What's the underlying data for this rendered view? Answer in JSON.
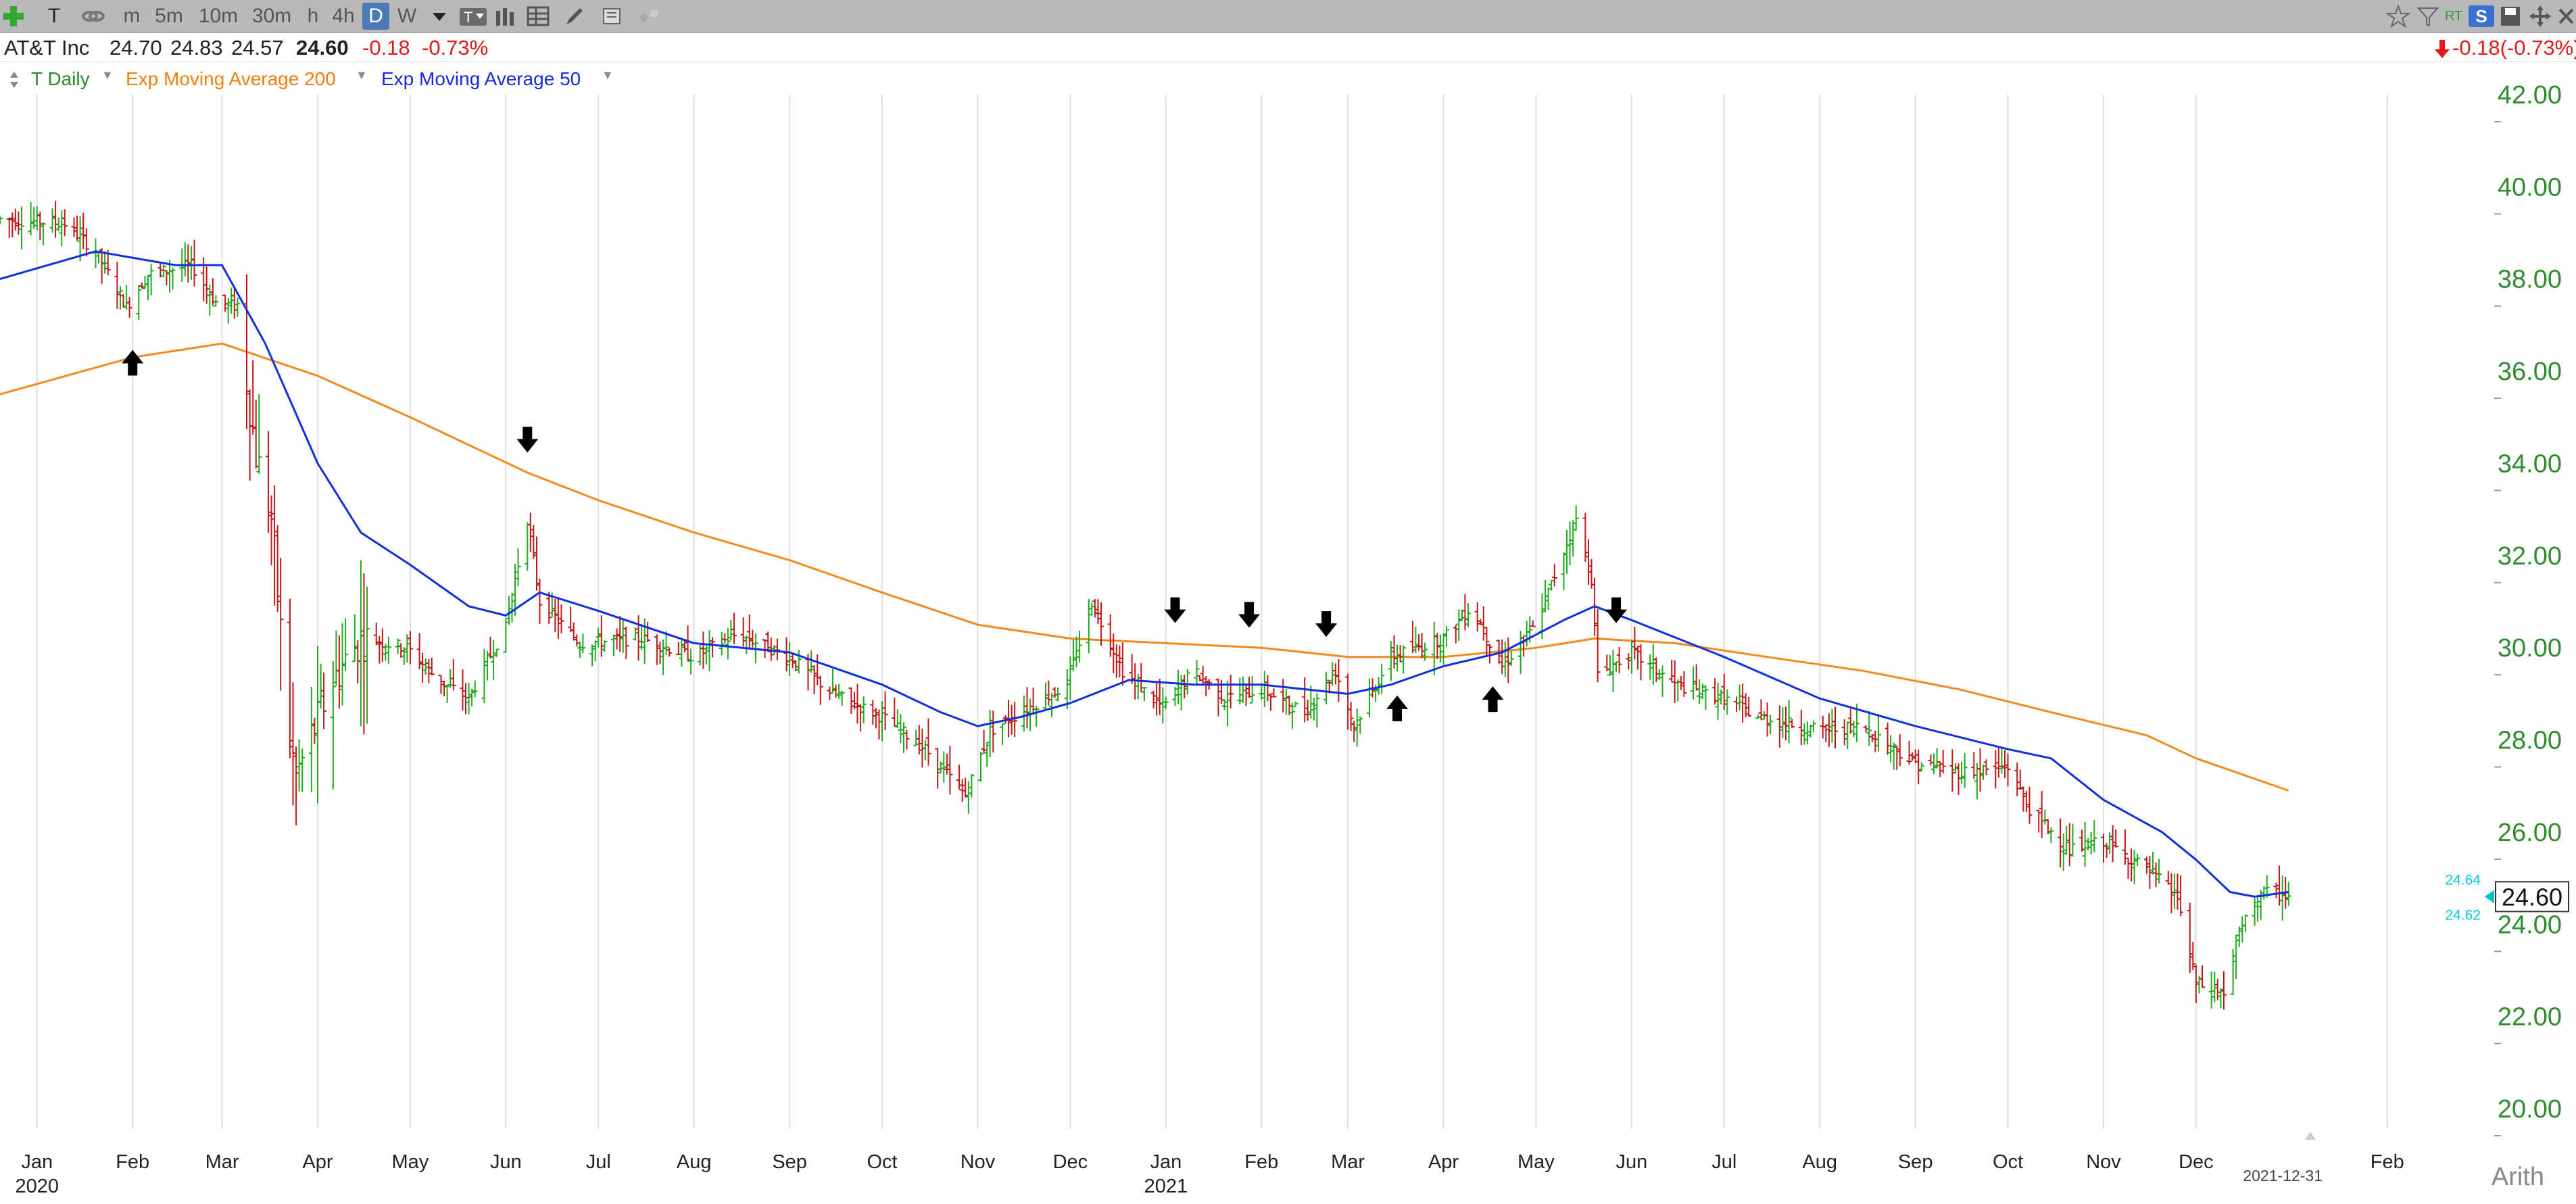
{
  "toolbar": {
    "items": [
      "T",
      "m",
      "5m",
      "10m",
      "30m",
      "h",
      "4h",
      "D",
      "W"
    ],
    "selected": "D",
    "right_items": [
      "RT",
      "S"
    ]
  },
  "info": {
    "name": "AT&T Inc",
    "open": "24.70",
    "high": "24.83",
    "low": "24.57",
    "close": "24.60",
    "change": "-0.18",
    "change_pct": "-0.73%",
    "right_change": "-0.18(-0.73%)"
  },
  "legend": {
    "series_main": "T Daily",
    "series_ema200": "Exp Moving Average 200",
    "series_ema50": "Exp Moving Average 50",
    "color_main": "#2a8a2a",
    "color_ema200": "#f07d0a",
    "color_ema50": "#1428e6"
  },
  "colors": {
    "up": "#1faa1f",
    "down": "#c01818",
    "ema200": "#f38a1f",
    "ema50": "#1030e0",
    "grid": "#dedede",
    "axis": "#2e8b2e"
  },
  "footer": {
    "scale_label": "Arith",
    "last_date_label": "2021-12-31"
  },
  "chart_data": {
    "type": "ohlc",
    "ylim": [
      20,
      42
    ],
    "yticks": [
      "42.00",
      "40.00",
      "38.00",
      "36.00",
      "34.00",
      "32.00",
      "30.00",
      "28.00",
      "26.00",
      "24.00",
      "22.00",
      "20.00"
    ],
    "last_price": "24.60",
    "side_labels": [
      "24.64",
      "24.62"
    ],
    "month_labels": [
      {
        "label": "Jan",
        "date": "2020-01-01"
      },
      {
        "label": "Feb",
        "date": "2020-02-01"
      },
      {
        "label": "Mar",
        "date": "2020-03-01"
      },
      {
        "label": "Apr",
        "date": "2020-04-01"
      },
      {
        "label": "May",
        "date": "2020-05-01"
      },
      {
        "label": "Jun",
        "date": "2020-06-01"
      },
      {
        "label": "Jul",
        "date": "2020-07-01"
      },
      {
        "label": "Aug",
        "date": "2020-08-01"
      },
      {
        "label": "Sep",
        "date": "2020-09-01"
      },
      {
        "label": "Oct",
        "date": "2020-10-01"
      },
      {
        "label": "Nov",
        "date": "2020-11-01"
      },
      {
        "label": "Dec",
        "date": "2020-12-01"
      },
      {
        "label": "Jan",
        "date": "2021-01-01"
      },
      {
        "label": "Feb",
        "date": "2021-02-01"
      },
      {
        "label": "Mar",
        "date": "2021-03-01"
      },
      {
        "label": "Apr",
        "date": "2021-04-01"
      },
      {
        "label": "May",
        "date": "2021-05-01"
      },
      {
        "label": "Jun",
        "date": "2021-06-01"
      },
      {
        "label": "Jul",
        "date": "2021-07-01"
      },
      {
        "label": "Aug",
        "date": "2021-08-01"
      },
      {
        "label": "Sep",
        "date": "2021-09-01"
      },
      {
        "label": "Oct",
        "date": "2021-10-01"
      },
      {
        "label": "Nov",
        "date": "2021-11-01"
      },
      {
        "label": "Dec",
        "date": "2021-12-01"
      },
      {
        "label": "Feb",
        "date": "2022-02-01"
      }
    ],
    "year_labels": [
      {
        "label": "2020",
        "date": "2020-01-01"
      },
      {
        "label": "2021",
        "date": "2021-01-01"
      }
    ],
    "x_start": "2019-12-20",
    "x_end": "2022-02-28",
    "price_path": [
      [
        "2019-12-20",
        39.3
      ],
      [
        "2020-01-10",
        39.2
      ],
      [
        "2020-01-20",
        38.6
      ],
      [
        "2020-01-30",
        37.4
      ],
      [
        "2020-02-06",
        38.1
      ],
      [
        "2020-02-20",
        38.3
      ],
      [
        "2020-02-28",
        37.5
      ],
      [
        "2020-03-06",
        37.4
      ],
      [
        "2020-03-12",
        34.2
      ],
      [
        "2020-03-17",
        32.8
      ],
      [
        "2020-03-23",
        28.0
      ],
      [
        "2020-03-25",
        27.2
      ],
      [
        "2020-04-06",
        29.3
      ],
      [
        "2020-04-15",
        30.2
      ],
      [
        "2020-04-30",
        30.0
      ],
      [
        "2020-05-10",
        29.3
      ],
      [
        "2020-05-20",
        28.9
      ],
      [
        "2020-06-01",
        30.5
      ],
      [
        "2020-06-08",
        32.8
      ],
      [
        "2020-06-12",
        31.0
      ],
      [
        "2020-06-25",
        30.1
      ],
      [
        "2020-07-15",
        30.2
      ],
      [
        "2020-08-01",
        29.8
      ],
      [
        "2020-08-15",
        30.3
      ],
      [
        "2020-09-01",
        29.8
      ],
      [
        "2020-09-15",
        29.0
      ],
      [
        "2020-10-01",
        28.5
      ],
      [
        "2020-10-15",
        27.8
      ],
      [
        "2020-10-28",
        26.8
      ],
      [
        "2020-11-05",
        28.2
      ],
      [
        "2020-11-15",
        28.6
      ],
      [
        "2020-11-30",
        29.2
      ],
      [
        "2020-12-08",
        31.0
      ],
      [
        "2020-12-18",
        29.5
      ],
      [
        "2020-12-31",
        28.7
      ],
      [
        "2021-01-10",
        29.5
      ],
      [
        "2021-01-20",
        28.9
      ],
      [
        "2021-02-01",
        29.1
      ],
      [
        "2021-02-15",
        28.6
      ],
      [
        "2021-02-25",
        29.5
      ],
      [
        "2021-03-03",
        28.3
      ],
      [
        "2021-03-15",
        29.8
      ],
      [
        "2021-04-01",
        30.2
      ],
      [
        "2021-04-10",
        30.9
      ],
      [
        "2021-04-20",
        29.6
      ],
      [
        "2021-04-30",
        30.4
      ],
      [
        "2021-05-05",
        31.2
      ],
      [
        "2021-05-14",
        32.8
      ],
      [
        "2021-05-19",
        31.5
      ],
      [
        "2021-05-21",
        29.4
      ],
      [
        "2021-06-01",
        29.9
      ],
      [
        "2021-06-15",
        29.2
      ],
      [
        "2021-07-01",
        28.9
      ],
      [
        "2021-07-12",
        28.5
      ],
      [
        "2021-08-01",
        28.2
      ],
      [
        "2021-08-15",
        28.3
      ],
      [
        "2021-09-01",
        27.5
      ],
      [
        "2021-09-15",
        27.3
      ],
      [
        "2021-10-01",
        27.4
      ],
      [
        "2021-10-08",
        26.5
      ],
      [
        "2021-10-21",
        25.6
      ],
      [
        "2021-11-01",
        25.8
      ],
      [
        "2021-11-15",
        25.2
      ],
      [
        "2021-11-25",
        24.6
      ],
      [
        "2021-12-01",
        22.7
      ],
      [
        "2021-12-10",
        22.5
      ],
      [
        "2021-12-15",
        23.8
      ],
      [
        "2021-12-22",
        24.7
      ],
      [
        "2021-12-31",
        24.6
      ]
    ],
    "ema200": [
      [
        "2019-12-20",
        35.5
      ],
      [
        "2020-02-01",
        36.3
      ],
      [
        "2020-03-01",
        36.6
      ],
      [
        "2020-04-01",
        35.9
      ],
      [
        "2020-05-01",
        35.0
      ],
      [
        "2020-06-08",
        33.8
      ],
      [
        "2020-07-01",
        33.2
      ],
      [
        "2020-08-01",
        32.5
      ],
      [
        "2020-09-01",
        31.9
      ],
      [
        "2020-10-01",
        31.2
      ],
      [
        "2020-11-01",
        30.5
      ],
      [
        "2020-12-01",
        30.2
      ],
      [
        "2021-01-01",
        30.1
      ],
      [
        "2021-02-01",
        30.0
      ],
      [
        "2021-03-01",
        29.8
      ],
      [
        "2021-04-01",
        29.8
      ],
      [
        "2021-05-01",
        30.0
      ],
      [
        "2021-05-20",
        30.2
      ],
      [
        "2021-06-15",
        30.1
      ],
      [
        "2021-07-15",
        29.8
      ],
      [
        "2021-08-15",
        29.5
      ],
      [
        "2021-09-15",
        29.1
      ],
      [
        "2021-10-15",
        28.6
      ],
      [
        "2021-11-15",
        28.1
      ],
      [
        "2021-12-01",
        27.6
      ],
      [
        "2021-12-31",
        26.9
      ]
    ],
    "ema50": [
      [
        "2019-12-20",
        38.0
      ],
      [
        "2020-01-20",
        38.6
      ],
      [
        "2020-02-15",
        38.3
      ],
      [
        "2020-03-01",
        38.3
      ],
      [
        "2020-03-15",
        36.6
      ],
      [
        "2020-04-01",
        34.0
      ],
      [
        "2020-04-15",
        32.5
      ],
      [
        "2020-05-01",
        31.8
      ],
      [
        "2020-05-20",
        30.9
      ],
      [
        "2020-06-01",
        30.7
      ],
      [
        "2020-06-12",
        31.2
      ],
      [
        "2020-07-01",
        30.8
      ],
      [
        "2020-08-01",
        30.1
      ],
      [
        "2020-09-01",
        29.9
      ],
      [
        "2020-10-01",
        29.2
      ],
      [
        "2020-10-20",
        28.6
      ],
      [
        "2020-11-01",
        28.3
      ],
      [
        "2020-11-15",
        28.5
      ],
      [
        "2020-12-01",
        28.8
      ],
      [
        "2020-12-20",
        29.3
      ],
      [
        "2021-01-10",
        29.2
      ],
      [
        "2021-02-01",
        29.2
      ],
      [
        "2021-03-01",
        29.0
      ],
      [
        "2021-03-15",
        29.2
      ],
      [
        "2021-04-01",
        29.6
      ],
      [
        "2021-04-20",
        29.9
      ],
      [
        "2021-05-10",
        30.6
      ],
      [
        "2021-05-20",
        30.9
      ],
      [
        "2021-06-01",
        30.6
      ],
      [
        "2021-07-01",
        29.8
      ],
      [
        "2021-08-01",
        28.9
      ],
      [
        "2021-09-01",
        28.3
      ],
      [
        "2021-10-01",
        27.8
      ],
      [
        "2021-10-15",
        27.6
      ],
      [
        "2021-11-01",
        26.7
      ],
      [
        "2021-11-20",
        26.0
      ],
      [
        "2021-12-01",
        25.4
      ],
      [
        "2021-12-12",
        24.7
      ],
      [
        "2021-12-20",
        24.6
      ],
      [
        "2021-12-31",
        24.7
      ]
    ],
    "arrows": [
      {
        "date": "2020-02-01",
        "price": 36.2,
        "dir": "up"
      },
      {
        "date": "2020-06-08",
        "price": 34.5,
        "dir": "down"
      },
      {
        "date": "2021-01-04",
        "price": 30.8,
        "dir": "down"
      },
      {
        "date": "2021-01-28",
        "price": 30.7,
        "dir": "down"
      },
      {
        "date": "2021-02-22",
        "price": 30.5,
        "dir": "down"
      },
      {
        "date": "2021-03-17",
        "price": 28.7,
        "dir": "up"
      },
      {
        "date": "2021-04-17",
        "price": 28.9,
        "dir": "up"
      },
      {
        "date": "2021-05-27",
        "price": 30.8,
        "dir": "down"
      }
    ]
  }
}
